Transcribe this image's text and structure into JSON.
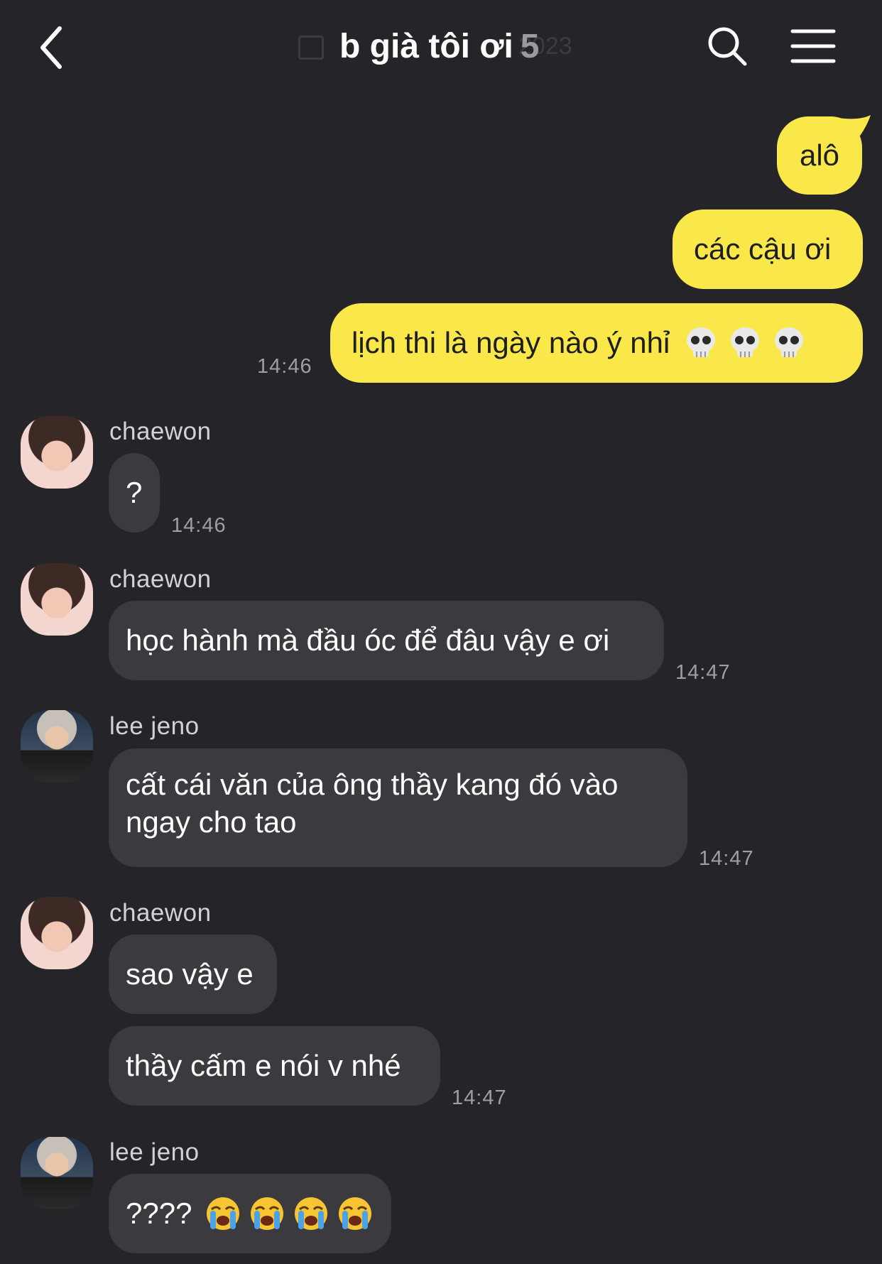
{
  "header": {
    "title": "b già tôi ơi",
    "member_count": "5",
    "date_ghost": "2023"
  },
  "messages": {
    "m1": "alô",
    "m2": "các cậu ơi",
    "m3": "lịch thi là ngày nào ý nhỉ",
    "m3_time": "14:46",
    "g1_sender": "chaewon",
    "m4": "?",
    "m4_time": "14:46",
    "g2_sender": "chaewon",
    "m5": "học hành mà đầu óc để đâu vậy e ơi",
    "m5_time": "14:47",
    "g3_sender": "lee jeno",
    "m6": "cất cái văn của ông thầy kang đó vào ngay cho tao",
    "m6_time": "14:47",
    "g4_sender": "chaewon",
    "m7": "sao vậy e",
    "m8": "thầy cấm e nói v nhé",
    "m8_time": "14:47",
    "g5_sender": "lee jeno",
    "m9": "????"
  },
  "icons": {
    "back": "chevron-left-icon",
    "search": "search-icon",
    "menu": "hamburger-menu-icon",
    "skull": "skull-emoji",
    "crying": "loudly-crying-emoji"
  },
  "colors": {
    "background": "#252529",
    "my_bubble": "#fae84b",
    "their_bubble": "#3b3b3f",
    "timestamp": "#9e9ea3"
  }
}
